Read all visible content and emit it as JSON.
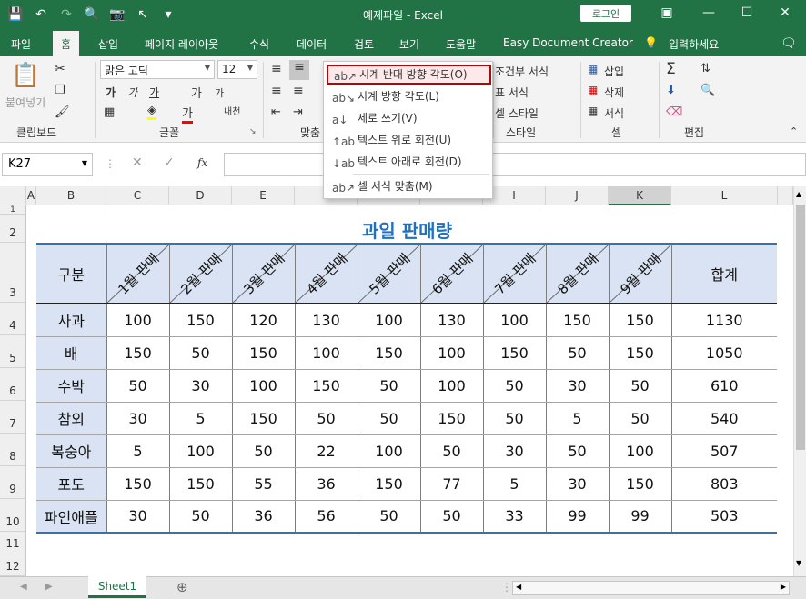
{
  "window": {
    "title": "예제파일 - Excel",
    "login_label": "로그인"
  },
  "menu": {
    "tabs": [
      "파일",
      "홈",
      "삽입",
      "페이지 레이아웃",
      "수식",
      "데이터",
      "검토",
      "보기",
      "도움말",
      "Easy Document Creator"
    ],
    "help_search": "입력하세요"
  },
  "ribbon": {
    "clipboard": {
      "paste": "붙여넣기",
      "label": "클립보드"
    },
    "font": {
      "name": "맑은 고딕",
      "size": "12",
      "label": "글꼴"
    },
    "alignment": {
      "label": "맞춤"
    },
    "styles": {
      "conditional": "조건부 서식",
      "table": "표 서식",
      "cell": "셀 스타일",
      "label": "스타일"
    },
    "cells": {
      "insert": "삽입",
      "delete": "삭제",
      "format": "서식",
      "label": "셀"
    },
    "editing": {
      "label": "편집"
    }
  },
  "formula_bar": {
    "name_box": "K27",
    "content": ""
  },
  "orientation_menu": {
    "items": [
      "시계 반대 방향 각도(O)",
      "시계 방향 각도(L)",
      "세로 쓰기(V)",
      "텍스트 위로 회전(U)",
      "텍스트 아래로 회전(D)",
      "셀 서식 맞춤(M)"
    ]
  },
  "sheet": {
    "column_headers": [
      "A",
      "B",
      "C",
      "D",
      "E",
      "F",
      "G",
      "H",
      "I",
      "J",
      "K",
      "L"
    ],
    "row_headers": [
      "1",
      "2",
      "3",
      "4",
      "5",
      "6",
      "7",
      "8",
      "9",
      "10",
      "11",
      "12"
    ],
    "title": "과일 판매량",
    "table": {
      "corner": "구분",
      "months": [
        "1월 판매",
        "2월 판매",
        "3월 판매",
        "4월 판매",
        "5월 판매",
        "6월 판매",
        "7월 판매",
        "8월 판매",
        "9월 판매"
      ],
      "total_header": "합계",
      "rows": [
        {
          "name": "사과",
          "values": [
            "100",
            "150",
            "120",
            "130",
            "100",
            "130",
            "100",
            "150",
            "150"
          ],
          "total": "1130"
        },
        {
          "name": "배",
          "values": [
            "150",
            "50",
            "150",
            "100",
            "150",
            "100",
            "150",
            "50",
            "150"
          ],
          "total": "1050"
        },
        {
          "name": "수박",
          "values": [
            "50",
            "30",
            "100",
            "150",
            "50",
            "100",
            "50",
            "30",
            "50"
          ],
          "total": "610"
        },
        {
          "name": "참외",
          "values": [
            "30",
            "5",
            "150",
            "50",
            "50",
            "150",
            "50",
            "5",
            "50"
          ],
          "total": "540"
        },
        {
          "name": "복숭아",
          "values": [
            "5",
            "100",
            "50",
            "22",
            "100",
            "50",
            "30",
            "50",
            "100"
          ],
          "total": "507"
        },
        {
          "name": "포도",
          "values": [
            "150",
            "150",
            "55",
            "36",
            "150",
            "77",
            "5",
            "30",
            "150"
          ],
          "total": "803"
        },
        {
          "name": "파인애플",
          "values": [
            "30",
            "50",
            "36",
            "56",
            "50",
            "50",
            "33",
            "99",
            "99"
          ],
          "total": "503"
        }
      ]
    },
    "tab_name": "Sheet1"
  }
}
